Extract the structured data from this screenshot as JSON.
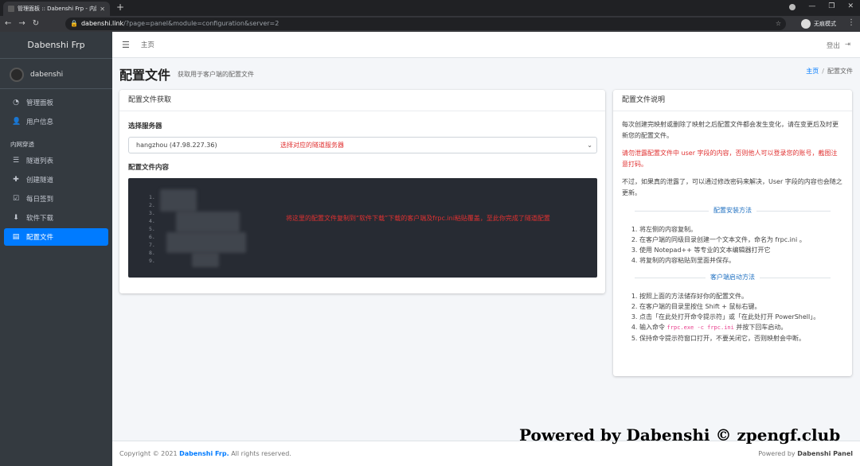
{
  "browser": {
    "tab_title": "管理面板 :: Dabenshi Frp - 内网",
    "url_host": "dabenshi.link",
    "url_rest": "/?page=panel&module=configuration&server=2",
    "profile_label": "无痕模式"
  },
  "sidebar": {
    "brand": "Dabenshi Frp",
    "username": "dabenshi",
    "items": [
      {
        "label": "管理面板",
        "icon": "tachometer-icon"
      },
      {
        "label": "用户信息",
        "icon": "user-icon"
      }
    ],
    "section_header": "内网穿透",
    "section_items": [
      {
        "label": "隧道列表",
        "icon": "list-icon"
      },
      {
        "label": "创建隧道",
        "icon": "plus-icon"
      },
      {
        "label": "每日签到",
        "icon": "checkbox-icon"
      },
      {
        "label": "软件下载",
        "icon": "download-icon"
      },
      {
        "label": "配置文件",
        "icon": "file-icon",
        "active": true
      }
    ]
  },
  "topnav": {
    "home": "主页",
    "logout": "登出"
  },
  "content_header": {
    "title": "配置文件",
    "subtitle": "获取用于客户端的配置文件",
    "breadcrumb_home": "主页",
    "breadcrumb_sep": "/",
    "breadcrumb_current": "配置文件"
  },
  "config_card": {
    "title": "配置文件获取",
    "server_label": "选择服务器",
    "server_selected": "hangzhou (47.98.227.36)",
    "server_hint": "选择对应的隧道服务器",
    "content_label": "配置文件内容",
    "line_numbers": [
      "1.",
      "2.",
      "3.",
      "4.",
      "5.",
      "6.",
      "7.",
      "8.",
      "9."
    ],
    "code_hint": "将这里的配置文件复制到“软件下载”下载的客户端及frpc.ini粘贴覆盖，至此你完成了隧道配置"
  },
  "help_card": {
    "title": "配置文件说明",
    "para1": "每次创建完映射或删除了映射之后配置文件都会发生变化，请在变更后及时更新您的配置文件。",
    "para2": "请勿泄露配置文件中 user 字段的内容，否则他人可以登录您的账号，截图注意打码。",
    "para3": "不过，如果真的泄露了，可以通过修改密码来解决，User 字段的内容也会随之更新。",
    "install_title": "配置安装方法",
    "install_steps": [
      "将左侧的内容复制。",
      "在客户端的同级目录创建一个文本文件，命名为 frpc.ini 。",
      "使用 Notepad++ 等专业的文本编辑器打开它",
      "将复制的内容粘贴到里面并保存。"
    ],
    "start_title": "客户端启动方法",
    "start_1": "按照上面的方法储存好你的配置文件。",
    "start_2": "在客户端的目录里按住 Shift + 鼠标右键。",
    "start_3": "点击「在此处打开命令提示符」或「在此处打开 PowerShell」。",
    "start_4_pre": "输入命令",
    "start_4_code": "frpc.exe -c frpc.ini",
    "start_4_post": "并按下回车启动。",
    "start_5": "保持命令提示符窗口打开，不要关闭它，否则映射会中断。"
  },
  "footer": {
    "copyright_pre": "Copyright © 2021",
    "brand": "Dabenshi Frp.",
    "copyright_post": "All rights reserved.",
    "powered_pre": "Powered by",
    "powered_brand": "Dabenshi Panel"
  },
  "watermark": "Powered by Dabenshi © zpengf.club"
}
